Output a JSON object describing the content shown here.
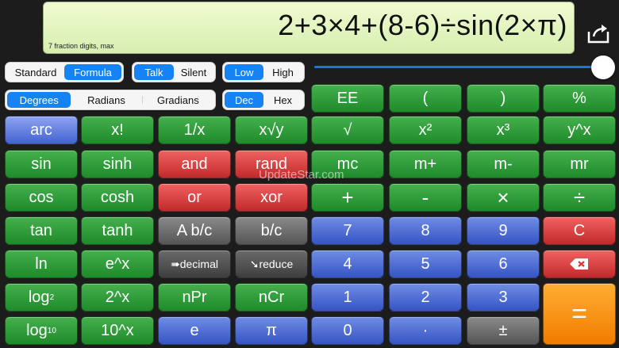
{
  "display": {
    "expression": "2+3×4+(8-6)÷sin(2×π)",
    "note": "7 fraction digits, max"
  },
  "toggles": {
    "mode": [
      "Standard",
      "Formula"
    ],
    "speech": [
      "Talk",
      "Silent"
    ],
    "precision": [
      "Low",
      "High"
    ],
    "angle": [
      "Degrees",
      "Radians",
      "Gradians"
    ],
    "base": [
      "Dec",
      "Hex"
    ]
  },
  "buttons": {
    "arc": "arc",
    "fact": "x!",
    "recip": "1/x",
    "xrooty": "x√y",
    "ee": "EE",
    "lparen": "(",
    "rparen": ")",
    "percent": "%",
    "sqrt": "√",
    "sq": "x²",
    "cube": "x³",
    "pow": "y^x",
    "sin": "sin",
    "sinh": "sinh",
    "and": "and",
    "rand": "rand",
    "mc": "mc",
    "mplus": "m+",
    "mminus": "m-",
    "mr": "mr",
    "cos": "cos",
    "cosh": "cosh",
    "or": "or",
    "xor": "xor",
    "plus": "+",
    "minus": "-",
    "times": "×",
    "divide": "÷",
    "tan": "tan",
    "tanh": "tanh",
    "abc": "A b/c",
    "bc": "b/c",
    "seven": "7",
    "eight": "8",
    "nine": "9",
    "clear": "C",
    "ln": "ln",
    "ex": "e^x",
    "decimal": "➠decimal",
    "reduce": "➘reduce",
    "four": "4",
    "five": "5",
    "six": "6",
    "log2": "log",
    "log2sub": "2",
    "twox": "2^x",
    "npr": "nPr",
    "ncr": "nCr",
    "one": "1",
    "two": "2",
    "three": "3",
    "equals": "=",
    "log10": "log",
    "log10sub": "10",
    "tenx": "10^x",
    "e": "e",
    "pi": "π",
    "zero": "0",
    "dot": "·",
    "plusminus": "±"
  },
  "watermark": "UpdateStar.com"
}
